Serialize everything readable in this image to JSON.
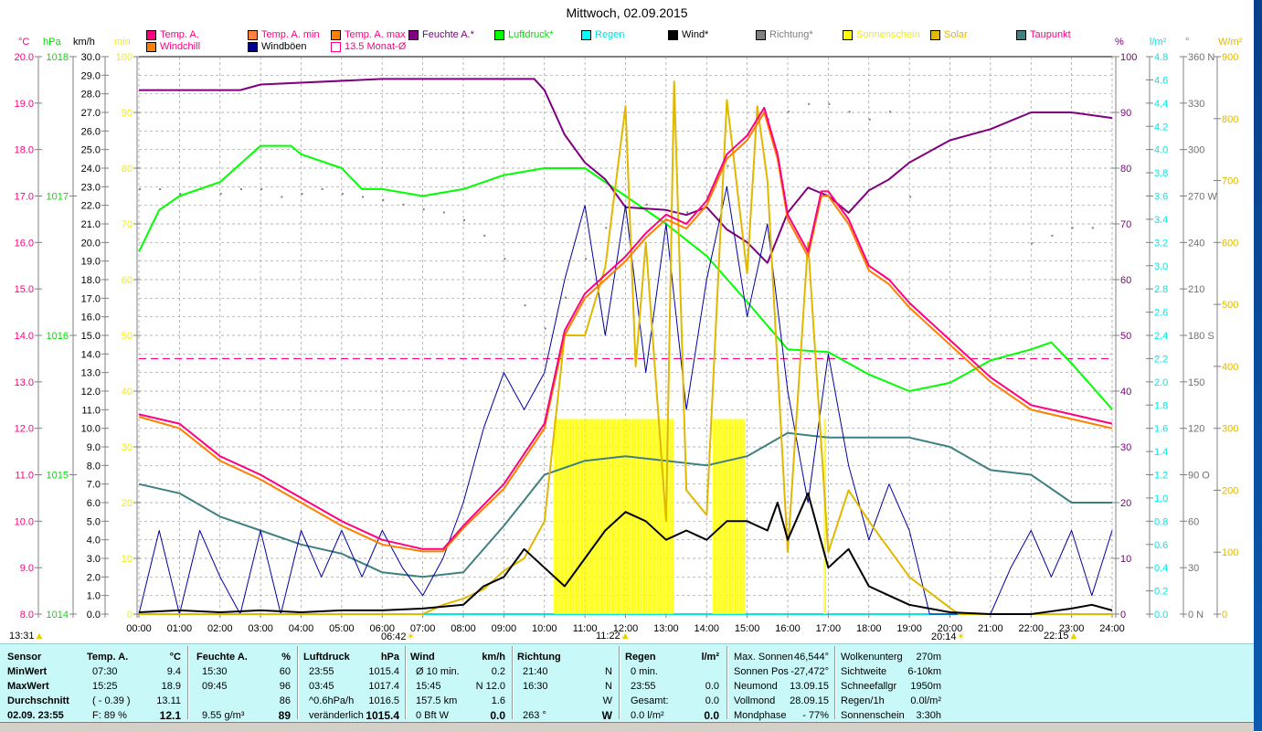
{
  "title": "Mittwoch, 02.09.2015",
  "legend": [
    {
      "label": "Temp. A.",
      "color": "#ff0080",
      "text_color": "#ff0080"
    },
    {
      "label": "Temp. A. min",
      "color": "#ff8040",
      "text_color": "#ff0080"
    },
    {
      "label": "Temp. A. max",
      "color": "#ff8000",
      "text_color": "#ff0080"
    },
    {
      "label": "Feuchte A.*",
      "color": "#800080",
      "text_color": "#800080"
    },
    {
      "label": "Luftdruck*",
      "color": "#00ff00",
      "text_color": "#00e000"
    },
    {
      "label": "Regen",
      "color": "#00ffff",
      "text_color": "#00e0e0"
    },
    {
      "label": "Wind*",
      "color": "#000000",
      "text_color": "#000000"
    },
    {
      "label": "Richtung*",
      "color": "#808080",
      "text_color": "#808080"
    },
    {
      "label": "Sonnenschein",
      "color": "#ffff00",
      "text_color": "#f0f000"
    },
    {
      "label": "Solar",
      "color": "#e0b800",
      "text_color": "#e0b800"
    },
    {
      "label": "Taupunkt",
      "color": "#408080",
      "text_color": "#ff0080"
    },
    {
      "label": "Windchill",
      "color": "#ff8000",
      "text_color": "#ff0080"
    },
    {
      "label": "Windböen",
      "color": "#000090",
      "text_color": "#000000"
    },
    {
      "label": "13.5 Monat-Ø",
      "color": "#ffffff",
      "text_color": "#ff0080"
    }
  ],
  "chart_data": {
    "type": "line",
    "title": "Mittwoch, 02.09.2015",
    "x_ticks": [
      "00:00",
      "01:00",
      "02:00",
      "03:00",
      "04:00",
      "05:00",
      "06:00",
      "07:00",
      "08:00",
      "09:00",
      "10:00",
      "11:00",
      "12:00",
      "13:00",
      "14:00",
      "15:00",
      "16:00",
      "17:00",
      "18:00",
      "19:00",
      "20:00",
      "21:00",
      "22:00",
      "23:00",
      "24:00"
    ],
    "xlim_hours": [
      0,
      24
    ],
    "grid": true,
    "axes": {
      "temp": {
        "unit": "°C",
        "range": [
          8,
          20
        ],
        "color": "#ff0080",
        "ticks": [
          "8.0",
          "9.0",
          "10.0",
          "11.0",
          "12.0",
          "13.0",
          "14.0",
          "15.0",
          "16.0",
          "17.0",
          "18.0",
          "19.0",
          "20.0"
        ]
      },
      "pressure": {
        "unit": "hPa",
        "range": [
          1014,
          1018
        ],
        "color": "#00e000",
        "ticks": [
          "1014",
          "1015",
          "1016",
          "1017",
          "1018"
        ]
      },
      "wind": {
        "unit": "km/h",
        "range": [
          0,
          30
        ],
        "color": "#000000",
        "ticks": [
          "0.0",
          "1.0",
          "2.0",
          "3.0",
          "4.0",
          "5.0",
          "6.0",
          "7.0",
          "8.0",
          "9.0",
          "10.0",
          "11.0",
          "12.0",
          "13.0",
          "14.0",
          "15.0",
          "16.0",
          "17.0",
          "18.0",
          "19.0",
          "20.0",
          "21.0",
          "22.0",
          "23.0",
          "24.0",
          "25.0",
          "26.0",
          "27.0",
          "28.0",
          "29.0",
          "30.0"
        ]
      },
      "minutes": {
        "unit": "min",
        "range": [
          0,
          100
        ],
        "color": "#f0f000",
        "ticks": [
          "0",
          "10",
          "20",
          "30",
          "40",
          "50",
          "60",
          "70",
          "80",
          "90",
          "100"
        ]
      },
      "humidity": {
        "unit": "%",
        "range": [
          0,
          100
        ],
        "color": "#800080",
        "ticks": [
          "0",
          "10",
          "20",
          "30",
          "40",
          "50",
          "60",
          "70",
          "80",
          "90",
          "100"
        ]
      },
      "rain": {
        "unit": "l/m²",
        "range": [
          0,
          4.8
        ],
        "color": "#00e8e8",
        "ticks": [
          "0.0",
          "0.2",
          "0.4",
          "0.6",
          "0.8",
          "1.0",
          "1.2",
          "1.4",
          "1.6",
          "1.8",
          "2.0",
          "2.2",
          "2.4",
          "2.6",
          "2.8",
          "3.0",
          "3.2",
          "3.4",
          "3.6",
          "3.8",
          "4.0",
          "4.2",
          "4.4",
          "4.6",
          "4.8"
        ]
      },
      "direction": {
        "unit": "°",
        "range": [
          0,
          360
        ],
        "color": "#808080",
        "ticks": [
          "0  N",
          "30",
          "60",
          "90  O",
          "120",
          "150",
          "180  S",
          "210",
          "240",
          "270  W",
          "300",
          "330",
          "360  N"
        ]
      },
      "solar": {
        "unit": "W/m²",
        "range": [
          0,
          900
        ],
        "color": "#e0b800",
        "ticks": [
          "0",
          "100",
          "200",
          "300",
          "400",
          "500",
          "600",
          "700",
          "800",
          "900"
        ]
      }
    },
    "monthly_avg_temp": 13.5,
    "series": [
      {
        "name": "Temp. A.",
        "axis": "temp",
        "color": "#ff0080",
        "x": [
          0,
          1,
          2,
          3,
          4,
          5,
          6,
          7,
          7.5,
          8,
          9,
          10,
          10.5,
          11,
          11.5,
          12,
          12.5,
          13,
          13.5,
          14,
          14.5,
          15,
          15.42,
          15.75,
          16,
          16.5,
          16.83,
          17,
          17.5,
          18,
          18.5,
          19,
          20,
          21,
          22,
          23,
          24
        ],
        "y": [
          12.3,
          12.1,
          11.4,
          11.0,
          10.5,
          10.0,
          9.6,
          9.4,
          9.4,
          9.9,
          10.8,
          12.1,
          14.1,
          14.9,
          15.3,
          15.7,
          16.2,
          16.6,
          16.4,
          16.9,
          17.9,
          18.3,
          18.9,
          17.9,
          16.6,
          15.8,
          17.1,
          17.1,
          16.5,
          15.5,
          15.2,
          14.7,
          13.9,
          13.1,
          12.5,
          12.3,
          12.1
        ]
      },
      {
        "name": "Windchill",
        "axis": "temp",
        "color": "#ff8000",
        "x": [
          0,
          1,
          2,
          3,
          4,
          5,
          6,
          7,
          7.5,
          8,
          9,
          10,
          10.5,
          11,
          11.5,
          12,
          12.5,
          13,
          13.5,
          14,
          14.5,
          15,
          15.42,
          15.75,
          16,
          16.5,
          16.83,
          17,
          17.5,
          18,
          18.5,
          19,
          20,
          21,
          22,
          23,
          24
        ],
        "y": [
          12.25,
          12.0,
          11.3,
          10.9,
          10.4,
          9.9,
          9.5,
          9.35,
          9.35,
          9.85,
          10.7,
          12.0,
          14.0,
          14.8,
          15.2,
          15.6,
          16.1,
          16.5,
          16.3,
          16.8,
          17.8,
          18.2,
          18.8,
          17.8,
          16.5,
          15.7,
          17.0,
          17.0,
          16.4,
          15.4,
          15.1,
          14.6,
          13.8,
          13.0,
          12.4,
          12.2,
          12.0
        ]
      },
      {
        "name": "Feuchte A.*",
        "axis": "humidity",
        "color": "#800080",
        "x": [
          0,
          2.5,
          3,
          6,
          9.75,
          10,
          10.5,
          11,
          11.5,
          12,
          13,
          13.5,
          14,
          14.5,
          15,
          15.5,
          16,
          16.5,
          17,
          17.5,
          18,
          18.5,
          19,
          20,
          21,
          22,
          23,
          24
        ],
        "y": [
          94,
          94,
          95,
          96,
          96,
          94,
          86,
          81,
          78,
          73,
          72.5,
          71.6,
          73,
          69,
          66.7,
          63,
          72,
          76.5,
          75,
          72,
          76,
          78,
          81,
          85,
          87,
          90,
          90,
          89
        ]
      },
      {
        "name": "Luftdruck*",
        "axis": "pressure",
        "color": "#00ff00",
        "x": [
          0,
          0.5,
          1,
          2,
          3,
          3.75,
          4,
          5,
          5.5,
          6,
          7,
          8,
          9,
          10,
          11,
          12,
          13,
          14,
          15,
          16,
          17,
          18,
          19,
          20,
          21,
          22,
          22.5,
          23,
          24
        ],
        "y": [
          1016.6,
          1016.9,
          1017.0,
          1017.1,
          1017.36,
          1017.36,
          1017.3,
          1017.2,
          1017.05,
          1017.05,
          1017.0,
          1017.05,
          1017.15,
          1017.2,
          1017.2,
          1017.0,
          1016.8,
          1016.57,
          1016.24,
          1015.9,
          1015.88,
          1015.72,
          1015.6,
          1015.66,
          1015.82,
          1015.9,
          1015.95,
          1015.8,
          1015.47
        ]
      },
      {
        "name": "Taupunkt",
        "axis": "temp",
        "color": "#408080",
        "x": [
          0,
          1,
          2,
          3,
          4,
          5,
          6,
          7,
          8,
          9,
          10,
          11,
          12,
          13,
          14,
          15,
          16,
          17,
          18,
          19,
          20,
          21,
          22,
          23,
          24
        ],
        "y": [
          10.8,
          10.6,
          10.1,
          9.8,
          9.5,
          9.3,
          8.9,
          8.8,
          8.9,
          9.9,
          11.0,
          11.3,
          11.4,
          11.3,
          11.2,
          11.4,
          11.9,
          11.8,
          11.8,
          11.8,
          11.6,
          11.1,
          11.0,
          10.4,
          10.4
        ]
      },
      {
        "name": "Windböen",
        "axis": "wind",
        "color": "#0000a0",
        "x": [
          0,
          0.5,
          1,
          1.5,
          2,
          2.5,
          3,
          3.5,
          4,
          4.5,
          5,
          5.5,
          6,
          6.5,
          7,
          7.5,
          8,
          8.5,
          9,
          9.5,
          10,
          10.5,
          11,
          11.5,
          12,
          12.5,
          13,
          13.5,
          14,
          14.5,
          15,
          15.5,
          16,
          16.5,
          17,
          17.5,
          18,
          18.5,
          19,
          19.5,
          20,
          20.5,
          21,
          21.5,
          22,
          22.5,
          23,
          23.5,
          24
        ],
        "y": [
          0,
          4.5,
          0,
          4.5,
          2,
          0,
          4.5,
          0,
          4.5,
          2,
          4.5,
          2,
          4.5,
          2.5,
          1,
          3,
          6,
          10,
          13,
          11,
          13,
          18,
          22,
          15,
          22,
          13,
          21,
          11,
          18,
          23,
          16,
          21,
          12,
          6,
          14,
          8,
          4,
          7,
          4.5,
          0,
          0,
          0,
          0,
          2.5,
          4.5,
          2,
          4.5,
          1,
          4.5
        ]
      },
      {
        "name": "Wind*",
        "axis": "wind",
        "color": "#000000",
        "x": [
          0,
          1,
          2,
          3,
          4,
          5,
          6,
          7,
          8,
          8.5,
          9,
          9.5,
          10,
          10.5,
          11,
          11.5,
          12,
          12.5,
          13,
          13.5,
          14,
          14.5,
          15,
          15.5,
          15.75,
          16,
          16.5,
          17,
          17.5,
          18,
          18.5,
          19,
          20,
          21,
          22,
          23,
          23.5,
          24
        ],
        "y": [
          0.1,
          0.2,
          0.1,
          0.2,
          0.1,
          0.2,
          0.2,
          0.3,
          0.5,
          1.5,
          2.0,
          3.5,
          2.5,
          1.5,
          3.0,
          4.5,
          5.5,
          5.0,
          4.0,
          4.5,
          4.0,
          5.0,
          5.0,
          4.5,
          6.0,
          4.0,
          6.5,
          2.5,
          3.5,
          1.5,
          1.0,
          0.5,
          0.1,
          0,
          0,
          0.3,
          0.5,
          0.2
        ]
      },
      {
        "name": "Solar",
        "axis": "solar",
        "color": "#e0b800",
        "x": [
          0,
          7,
          7.5,
          8,
          8.5,
          9,
          9.5,
          10,
          10.5,
          11,
          11.5,
          12,
          12.25,
          12.5,
          13,
          13.2,
          13.5,
          14,
          14.5,
          15,
          15.25,
          15.5,
          16,
          16.5,
          17,
          17.5,
          18,
          19,
          20,
          20.23,
          24
        ],
        "y": [
          0,
          0,
          15,
          25,
          40,
          70,
          90,
          150,
          450,
          450,
          560,
          820,
          400,
          600,
          150,
          860,
          200,
          160,
          830,
          550,
          820,
          700,
          100,
          600,
          100,
          200,
          150,
          60,
          10,
          0,
          0
        ]
      }
    ],
    "direction_points": {
      "axis": "direction",
      "color": "#808080",
      "x": [
        0,
        0.5,
        1,
        1.5,
        2,
        2.5,
        3,
        3.5,
        4,
        4.5,
        5,
        5.5,
        6,
        6.5,
        7,
        7.5,
        8,
        8.5,
        9,
        9.5,
        10,
        10.5,
        11,
        11.5,
        12,
        12.5,
        13,
        13.5,
        14,
        14.5,
        15,
        15.5,
        16,
        16.5,
        17,
        17.5,
        18,
        18.5,
        19,
        22,
        22.5,
        23,
        23.5
      ],
      "y": [
        275,
        275,
        272,
        275,
        272,
        275,
        275,
        270,
        272,
        275,
        272,
        270,
        268,
        265,
        262,
        260,
        255,
        245,
        230,
        200,
        185,
        205,
        230,
        250,
        270,
        265,
        255,
        260,
        270,
        290,
        310,
        320,
        325,
        330,
        330,
        325,
        320,
        325,
        270,
        240,
        245,
        250,
        250
      ]
    },
    "sunshine_hours": [
      [
        10.25,
        12.95
      ],
      [
        13.0,
        13.17
      ],
      [
        14.17,
        14.95
      ],
      [
        16.9,
        16.95
      ]
    ],
    "rain": 0
  },
  "events": [
    {
      "time": "13:31",
      "icon": "moon-icon"
    },
    {
      "time": "06:42",
      "icon": "sunrise-icon"
    },
    {
      "time": "11:22",
      "icon": "moon-icon"
    },
    {
      "time": "20:14",
      "icon": "sunset-icon"
    },
    {
      "time": "22:15",
      "icon": "moon-icon"
    }
  ],
  "table": {
    "sensor": {
      "header": "Sensor",
      "rows": [
        "MinWert",
        "MaxWert",
        "Durchschnitt",
        "02.09. 23:55"
      ]
    },
    "sections": [
      {
        "header": "Temp. A.",
        "unit": "°C",
        "rows": [
          [
            "07:30",
            "9.4"
          ],
          [
            "15:25",
            "18.9"
          ],
          [
            "( - 0.39 )",
            "13.11"
          ],
          [
            "F: 89 %",
            "12.1"
          ]
        ]
      },
      {
        "header": "Feuchte A.",
        "unit": "%",
        "rows": [
          [
            "15:30",
            "60"
          ],
          [
            "09:45",
            "96"
          ],
          [
            "",
            "86"
          ],
          [
            "9.55 g/m³",
            "89"
          ]
        ]
      },
      {
        "header": "Luftdruck",
        "unit": "hPa",
        "rows": [
          [
            "23:55",
            "1015.4"
          ],
          [
            "03:45",
            "1017.4"
          ],
          [
            "^0.6hPa/h",
            "1016.5"
          ],
          [
            "veränderlich",
            "1015.4"
          ]
        ]
      },
      {
        "header": "Wind",
        "unit": "km/h",
        "rows": [
          [
            "Ø 10 min.",
            "0.2"
          ],
          [
            "15:45",
            "N 12.0"
          ],
          [
            "157.5 km",
            "1.6"
          ],
          [
            "0 Bft W",
            "0.0"
          ]
        ]
      },
      {
        "header": "Richtung",
        "unit": "",
        "rows": [
          [
            "21:40",
            "N"
          ],
          [
            "16:30",
            "N"
          ],
          [
            "",
            "W"
          ],
          [
            "263 °",
            "W"
          ]
        ]
      },
      {
        "header": "Regen",
        "unit": "l/m²",
        "rows": [
          [
            "0 min.",
            ""
          ],
          [
            "23:55",
            "0.0"
          ],
          [
            "Gesamt:",
            "0.0"
          ],
          [
            "0.0 l/m²",
            "0.0"
          ]
        ]
      },
      {
        "header": "",
        "unit": "",
        "rows5": [
          [
            "Max. Sonnen",
            "46,544°"
          ],
          [
            "Sonnen Pos",
            "-27,472°"
          ],
          [
            "Neumond",
            "13.09.15"
          ],
          [
            "Vollmond",
            "28.09.15"
          ],
          [
            "Mondphase",
            "- 77%"
          ]
        ]
      },
      {
        "header": "",
        "unit": "",
        "rows5": [
          [
            "Wolkenunterg",
            "270m"
          ],
          [
            "Sichtweite",
            "6-10km"
          ],
          [
            "Schneefallgr",
            "1950m"
          ],
          [
            "Regen/1h",
            "0.0l/m²"
          ],
          [
            "Sonnenschein",
            "3:30h"
          ]
        ]
      }
    ]
  }
}
